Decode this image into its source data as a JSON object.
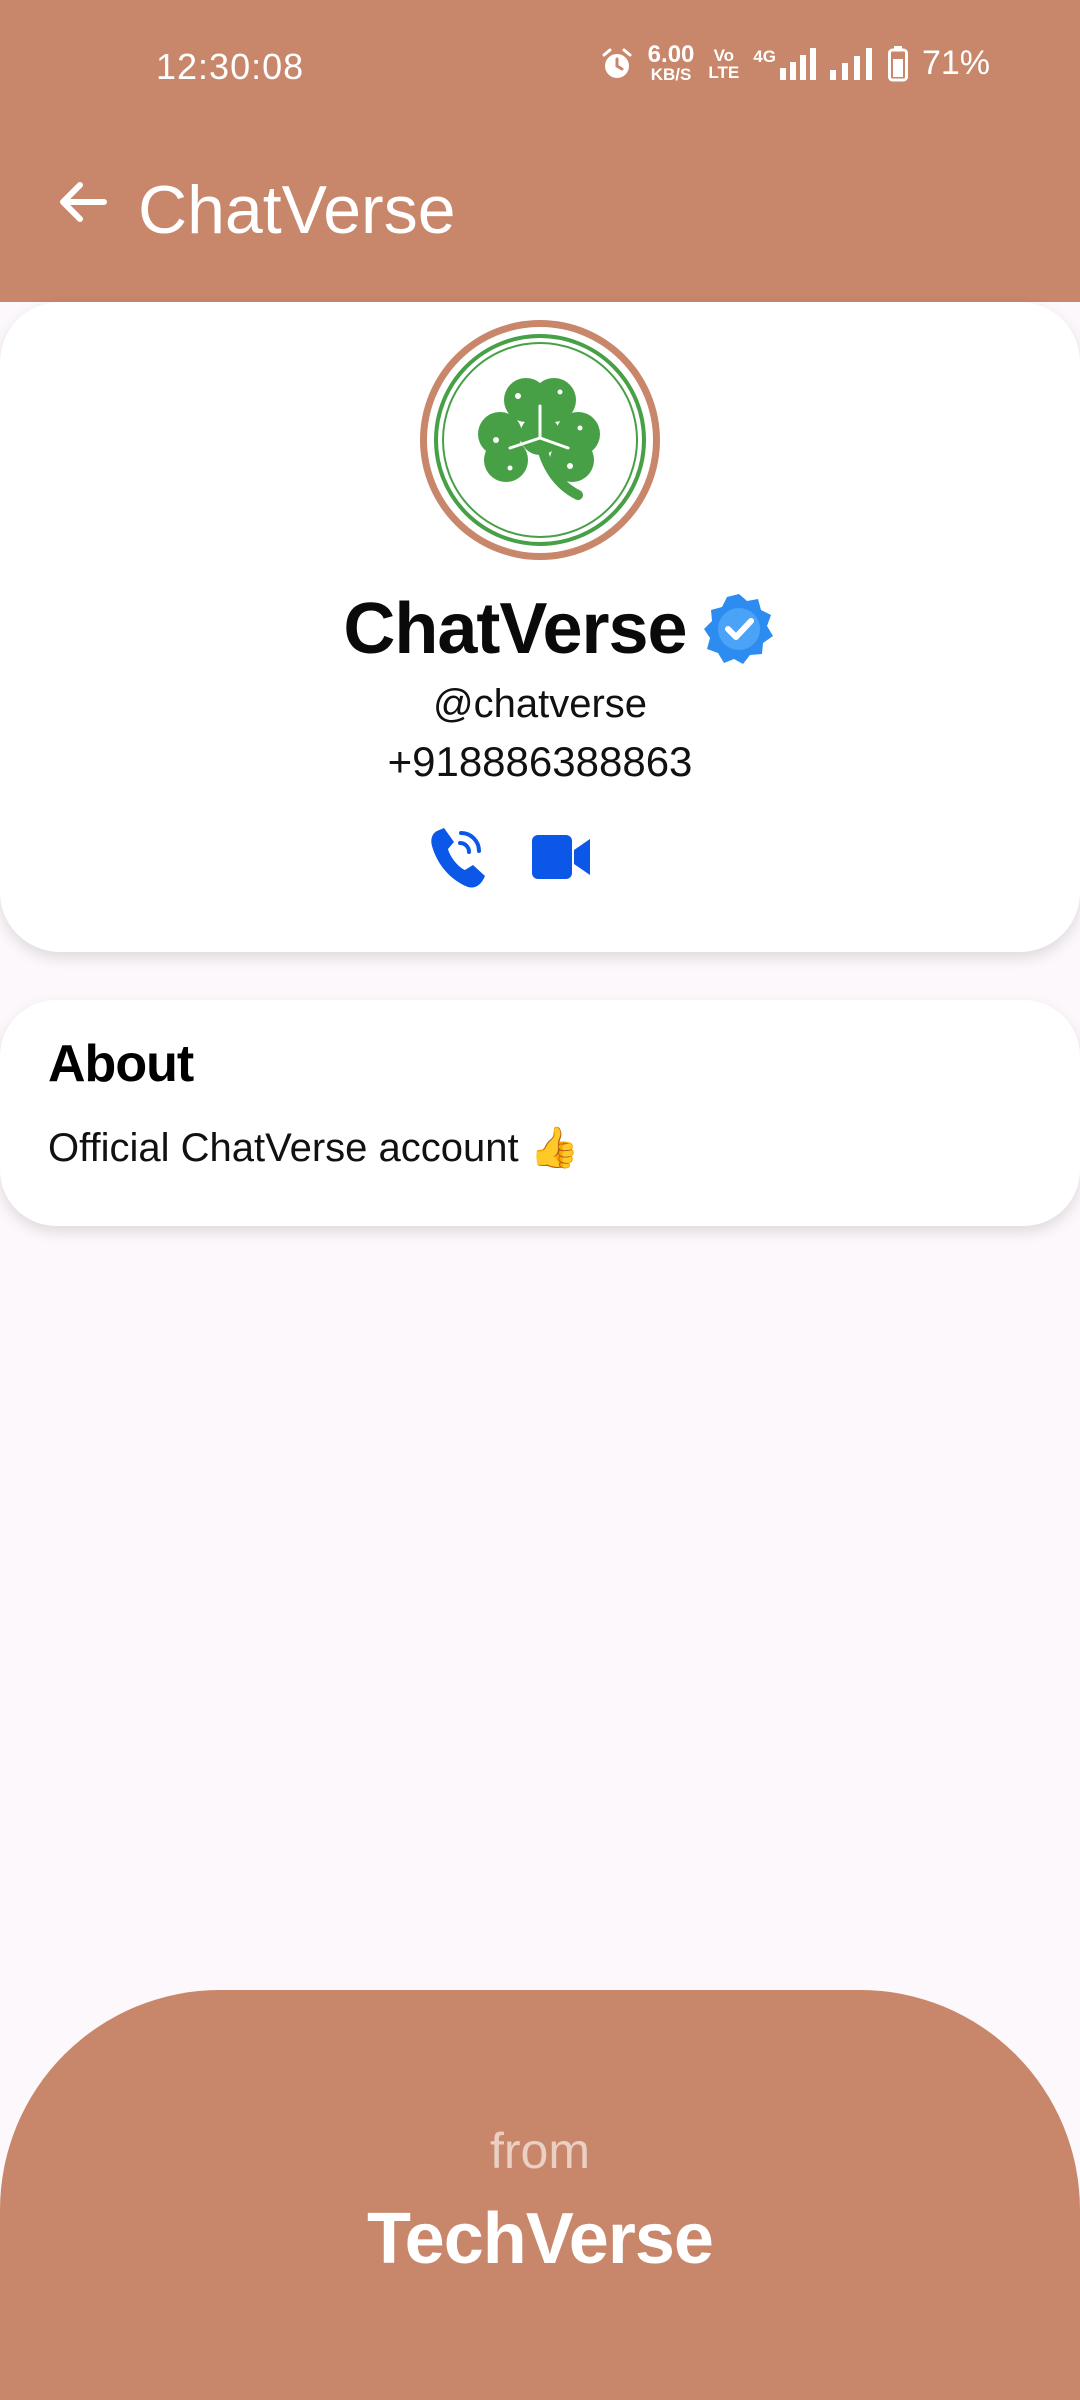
{
  "status_bar": {
    "time": "12:30:08",
    "speed_value": "6.00",
    "speed_unit": "KB/S",
    "volte_top": "Vo",
    "volte_bottom": "LTE",
    "network_type": "4G",
    "battery_percent": "71%"
  },
  "header": {
    "title": "ChatVerse"
  },
  "profile": {
    "name": "ChatVerse",
    "handle": "@chatverse",
    "phone": "+918886388863",
    "verified": true
  },
  "about": {
    "title": "About",
    "text": "Official ChatVerse account 👍"
  },
  "footer": {
    "from_label": "from",
    "brand": "TechVerse"
  },
  "colors": {
    "header_bg": "#c8866a",
    "footer_bg": "#c8866a",
    "page_bg": "#fdf8fb",
    "card_bg": "#ffffff",
    "verified_blue": "#2d8cf0",
    "action_blue": "#0b57e8",
    "clover_green": "#47a046"
  },
  "icons": {
    "back": "arrow-left-icon",
    "verified": "verified-badge-icon",
    "call": "phone-call-icon",
    "video": "video-camera-icon",
    "avatar": "clover-icon",
    "alarm": "alarm-icon",
    "signal": "signal-bars-icon",
    "battery": "battery-icon"
  }
}
